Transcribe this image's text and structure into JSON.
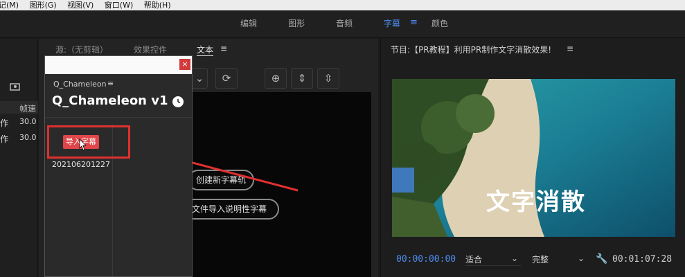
{
  "menubar": {
    "items": [
      "记(M)",
      "图形(G)",
      "视图(V)",
      "窗口(W)",
      "帮助(H)"
    ]
  },
  "workspace": {
    "tabs": [
      "编辑",
      "图形",
      "音频",
      "字幕",
      "颜色"
    ],
    "active": "字幕",
    "menu_icon": "hamburger-menu-icon"
  },
  "left_strip": {
    "header": "帧速",
    "rows": [
      {
        "label": "作",
        "value": "30.0"
      },
      {
        "label": "作",
        "value": "30.0"
      }
    ],
    "icon": "folder-search-icon"
  },
  "effects_panel": {
    "tabs": [
      "源:（无剪辑）",
      "效果控件",
      "文本"
    ],
    "active_tab": "文本",
    "tools": [
      "chevron-down-icon",
      "refresh-icon",
      "add-circle-icon",
      "split-vertical-icon",
      "merge-vertical-icon"
    ],
    "buttons": {
      "create_track": "创建新字幕轨",
      "import_file": "文件导入说明性字幕"
    }
  },
  "plugin": {
    "close_label": "×",
    "subtitle": "Q_Chameleon",
    "menu_icon": "hamburger-menu-icon",
    "title": "Q_Chameleon v1",
    "import_button": "导入字幕",
    "timestamp": "202106201227"
  },
  "program_monitor": {
    "title": "节目:【PR教程】利用PR制作文字消散效果!",
    "menu_icon": "hamburger-menu-icon",
    "overlay_text": "文字消散",
    "timecode_current": "00:00:00:00",
    "fit": "适合",
    "quality": "完整",
    "timecode_total": "00:01:07:28"
  },
  "colors": {
    "accent": "#4d8df0",
    "highlight": "#e03030",
    "import_button": "#e0454a"
  }
}
